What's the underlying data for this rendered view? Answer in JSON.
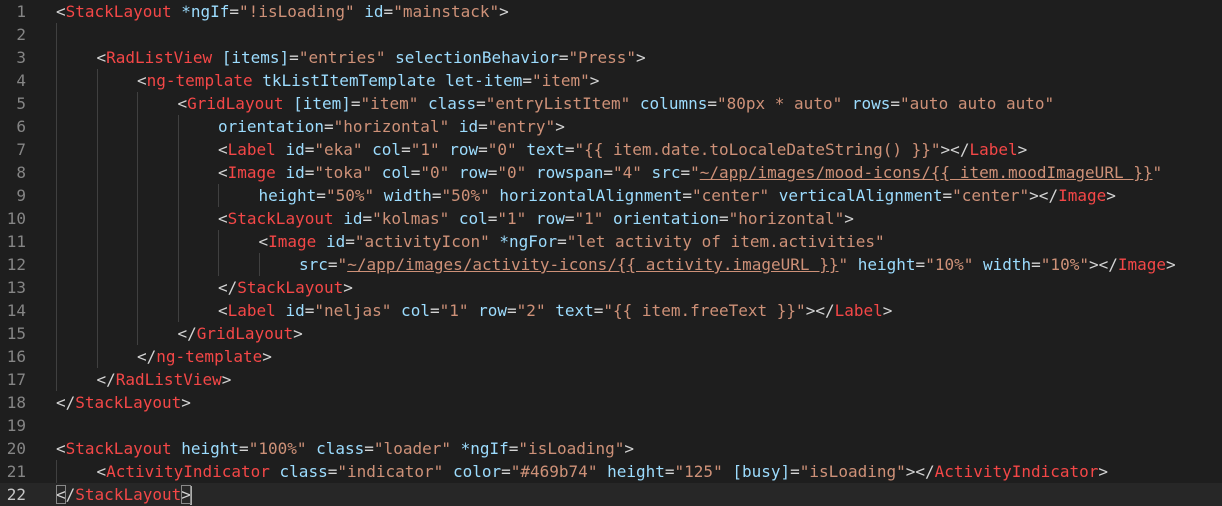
{
  "editor": {
    "colors": {
      "background": "#1e1e1e",
      "current_line": "#272727",
      "line_number": "#858585",
      "punct": "#d4d4d4",
      "tag": "#f44747",
      "attr": "#9cdcfe",
      "string": "#ce9178",
      "text": "#d4d4d4"
    },
    "current_line": 22,
    "lines": [
      {
        "n": "1",
        "indent": 0,
        "tokens": [
          [
            "p",
            "<"
          ],
          [
            "t",
            "StackLayout"
          ],
          [
            "a",
            " *ngIf"
          ],
          [
            "p",
            "="
          ],
          [
            "s",
            "\"!isLoading\""
          ],
          [
            "a",
            " id"
          ],
          [
            "p",
            "="
          ],
          [
            "s",
            "\"mainstack\""
          ],
          [
            "p",
            ">"
          ]
        ]
      },
      {
        "n": "2",
        "indent": 1,
        "tokens": []
      },
      {
        "n": "3",
        "indent": 1,
        "tokens": [
          [
            "p",
            "<"
          ],
          [
            "t",
            "RadListView"
          ],
          [
            "a",
            " [items]"
          ],
          [
            "p",
            "="
          ],
          [
            "s",
            "\"entries\""
          ],
          [
            "a",
            " selectionBehavior"
          ],
          [
            "p",
            "="
          ],
          [
            "s",
            "\"Press\""
          ],
          [
            "p",
            ">"
          ]
        ]
      },
      {
        "n": "4",
        "indent": 2,
        "tokens": [
          [
            "p",
            "<"
          ],
          [
            "t",
            "ng-template"
          ],
          [
            "a",
            " tkListItemTemplate"
          ],
          [
            "a",
            " let-item"
          ],
          [
            "p",
            "="
          ],
          [
            "s",
            "\"item\""
          ],
          [
            "p",
            ">"
          ]
        ]
      },
      {
        "n": "5",
        "indent": 3,
        "tokens": [
          [
            "p",
            "<"
          ],
          [
            "t",
            "GridLayout"
          ],
          [
            "a",
            " [item]"
          ],
          [
            "p",
            "="
          ],
          [
            "s",
            "\"item\""
          ],
          [
            "a",
            " class"
          ],
          [
            "p",
            "="
          ],
          [
            "s",
            "\"entryListItem\""
          ],
          [
            "a",
            " columns"
          ],
          [
            "p",
            "="
          ],
          [
            "s",
            "\"80px * auto\""
          ],
          [
            "a",
            " rows"
          ],
          [
            "p",
            "="
          ],
          [
            "s",
            "\"auto auto auto\""
          ]
        ]
      },
      {
        "n": "6",
        "indent": 4,
        "tokens": [
          [
            "a",
            "orientation"
          ],
          [
            "p",
            "="
          ],
          [
            "s",
            "\"horizontal\""
          ],
          [
            "a",
            " id"
          ],
          [
            "p",
            "="
          ],
          [
            "s",
            "\"entry\""
          ],
          [
            "p",
            ">"
          ]
        ]
      },
      {
        "n": "7",
        "indent": 4,
        "tokens": [
          [
            "p",
            "<"
          ],
          [
            "t",
            "Label"
          ],
          [
            "a",
            " id"
          ],
          [
            "p",
            "="
          ],
          [
            "s",
            "\"eka\""
          ],
          [
            "a",
            " col"
          ],
          [
            "p",
            "="
          ],
          [
            "s",
            "\"1\""
          ],
          [
            "a",
            " row"
          ],
          [
            "p",
            "="
          ],
          [
            "s",
            "\"0\""
          ],
          [
            "a",
            " text"
          ],
          [
            "p",
            "="
          ],
          [
            "s",
            "\"{{ item.date.toLocaleDateString() }}\""
          ],
          [
            "p",
            "></"
          ],
          [
            "t",
            "Label"
          ],
          [
            "p",
            ">"
          ]
        ]
      },
      {
        "n": "8",
        "indent": 4,
        "tokens": [
          [
            "p",
            "<"
          ],
          [
            "t",
            "Image"
          ],
          [
            "a",
            " id"
          ],
          [
            "p",
            "="
          ],
          [
            "s",
            "\"toka\""
          ],
          [
            "a",
            " col"
          ],
          [
            "p",
            "="
          ],
          [
            "s",
            "\"0\""
          ],
          [
            "a",
            " row"
          ],
          [
            "p",
            "="
          ],
          [
            "s",
            "\"0\""
          ],
          [
            "a",
            " rowspan"
          ],
          [
            "p",
            "="
          ],
          [
            "s",
            "\"4\""
          ],
          [
            "a",
            " src"
          ],
          [
            "p",
            "="
          ],
          [
            "s",
            "\""
          ],
          [
            "u",
            "~/app/images/mood-icons/{{ item.moodImageURL }}"
          ],
          [
            "s",
            "\""
          ]
        ]
      },
      {
        "n": "9",
        "indent": 5,
        "tokens": [
          [
            "a",
            "height"
          ],
          [
            "p",
            "="
          ],
          [
            "s",
            "\"50%\""
          ],
          [
            "a",
            " width"
          ],
          [
            "p",
            "="
          ],
          [
            "s",
            "\"50%\""
          ],
          [
            "a",
            " horizontalAlignment"
          ],
          [
            "p",
            "="
          ],
          [
            "s",
            "\"center\""
          ],
          [
            "a",
            " verticalAlignment"
          ],
          [
            "p",
            "="
          ],
          [
            "s",
            "\"center\""
          ],
          [
            "p",
            "></"
          ],
          [
            "t",
            "Image"
          ],
          [
            "p",
            ">"
          ]
        ]
      },
      {
        "n": "10",
        "indent": 4,
        "tokens": [
          [
            "p",
            "<"
          ],
          [
            "t",
            "StackLayout"
          ],
          [
            "a",
            " id"
          ],
          [
            "p",
            "="
          ],
          [
            "s",
            "\"kolmas\""
          ],
          [
            "a",
            " col"
          ],
          [
            "p",
            "="
          ],
          [
            "s",
            "\"1\""
          ],
          [
            "a",
            " row"
          ],
          [
            "p",
            "="
          ],
          [
            "s",
            "\"1\""
          ],
          [
            "a",
            " orientation"
          ],
          [
            "p",
            "="
          ],
          [
            "s",
            "\"horizontal\""
          ],
          [
            "p",
            ">"
          ]
        ]
      },
      {
        "n": "11",
        "indent": 5,
        "tokens": [
          [
            "p",
            "<"
          ],
          [
            "t",
            "Image"
          ],
          [
            "a",
            " id"
          ],
          [
            "p",
            "="
          ],
          [
            "s",
            "\"activityIcon\""
          ],
          [
            "a",
            " *ngFor"
          ],
          [
            "p",
            "="
          ],
          [
            "s",
            "\"let activity of item.activities\""
          ]
        ]
      },
      {
        "n": "12",
        "indent": 6,
        "tokens": [
          [
            "a",
            "src"
          ],
          [
            "p",
            "="
          ],
          [
            "s",
            "\""
          ],
          [
            "u",
            "~/app/images/activity-icons/{{ activity.imageURL }}"
          ],
          [
            "s",
            "\""
          ],
          [
            "a",
            " height"
          ],
          [
            "p",
            "="
          ],
          [
            "s",
            "\"10%\""
          ],
          [
            "a",
            " width"
          ],
          [
            "p",
            "="
          ],
          [
            "s",
            "\"10%\""
          ],
          [
            "p",
            "></"
          ],
          [
            "t",
            "Image"
          ],
          [
            "p",
            ">"
          ]
        ]
      },
      {
        "n": "13",
        "indent": 4,
        "tokens": [
          [
            "p",
            "</"
          ],
          [
            "t",
            "StackLayout"
          ],
          [
            "p",
            ">"
          ]
        ]
      },
      {
        "n": "14",
        "indent": 4,
        "tokens": [
          [
            "p",
            "<"
          ],
          [
            "t",
            "Label"
          ],
          [
            "a",
            " id"
          ],
          [
            "p",
            "="
          ],
          [
            "s",
            "\"neljas\""
          ],
          [
            "a",
            " col"
          ],
          [
            "p",
            "="
          ],
          [
            "s",
            "\"1\""
          ],
          [
            "a",
            " row"
          ],
          [
            "p",
            "="
          ],
          [
            "s",
            "\"2\""
          ],
          [
            "a",
            " text"
          ],
          [
            "p",
            "="
          ],
          [
            "s",
            "\"{{ item.freeText }}\""
          ],
          [
            "p",
            "></"
          ],
          [
            "t",
            "Label"
          ],
          [
            "p",
            ">"
          ]
        ]
      },
      {
        "n": "15",
        "indent": 3,
        "tokens": [
          [
            "p",
            "</"
          ],
          [
            "t",
            "GridLayout"
          ],
          [
            "p",
            ">"
          ]
        ]
      },
      {
        "n": "16",
        "indent": 2,
        "tokens": [
          [
            "p",
            "</"
          ],
          [
            "t",
            "ng-template"
          ],
          [
            "p",
            ">"
          ]
        ]
      },
      {
        "n": "17",
        "indent": 1,
        "tokens": [
          [
            "p",
            "</"
          ],
          [
            "t",
            "RadListView"
          ],
          [
            "p",
            ">"
          ]
        ]
      },
      {
        "n": "18",
        "indent": 0,
        "tokens": [
          [
            "p",
            "</"
          ],
          [
            "t",
            "StackLayout"
          ],
          [
            "p",
            ">"
          ]
        ]
      },
      {
        "n": "19",
        "indent": 0,
        "tokens": []
      },
      {
        "n": "20",
        "indent": 0,
        "tokens": [
          [
            "p",
            "<"
          ],
          [
            "t",
            "StackLayout"
          ],
          [
            "a",
            " height"
          ],
          [
            "p",
            "="
          ],
          [
            "s",
            "\"100%\""
          ],
          [
            "a",
            " class"
          ],
          [
            "p",
            "="
          ],
          [
            "s",
            "\"loader\""
          ],
          [
            "a",
            " *ngIf"
          ],
          [
            "p",
            "="
          ],
          [
            "s",
            "\"isLoading\""
          ],
          [
            "p",
            ">"
          ]
        ]
      },
      {
        "n": "21",
        "indent": 1,
        "tokens": [
          [
            "p",
            "<"
          ],
          [
            "t",
            "ActivityIndicator"
          ],
          [
            "a",
            " class"
          ],
          [
            "p",
            "="
          ],
          [
            "s",
            "\"indicator\""
          ],
          [
            "a",
            " color"
          ],
          [
            "p",
            "="
          ],
          [
            "s",
            "\"#469b74\""
          ],
          [
            "a",
            " height"
          ],
          [
            "p",
            "="
          ],
          [
            "s",
            "\"125\""
          ],
          [
            "a",
            " [busy]"
          ],
          [
            "p",
            "="
          ],
          [
            "s",
            "\"isLoading\""
          ],
          [
            "p",
            "></"
          ],
          [
            "t",
            "ActivityIndicator"
          ],
          [
            "p",
            ">"
          ]
        ]
      },
      {
        "n": "22",
        "indent": 0,
        "tokens": [
          [
            "b",
            "<"
          ],
          [
            "p",
            "/"
          ],
          [
            "t",
            "StackLayout"
          ],
          [
            "b",
            ">"
          ],
          [
            "c",
            ""
          ]
        ]
      }
    ]
  }
}
